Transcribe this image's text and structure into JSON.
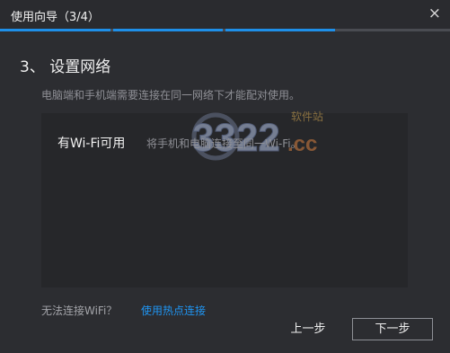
{
  "window": {
    "title": "使用向导（3/4）",
    "close_icon": "close-icon",
    "close_glyph": "×"
  },
  "progress": {
    "total_steps": 4,
    "current_step": 3,
    "active_color": "#1e8fe8",
    "inactive_color": "#4a4c52"
  },
  "step": {
    "title": "3、 设置网络",
    "subtitle": "电脑端和手机端需要连接在同一网络下才能配对使用。"
  },
  "wifi_option": {
    "title": "有Wi-Fi可用",
    "description": "将手机和电脑连接至同一Wi-Fi。"
  },
  "watermark": {
    "text": "3322",
    "suffix": ".cc",
    "tag": "软件站"
  },
  "help": {
    "text": "无法连接WiFi？",
    "link_label": "使用热点连接",
    "link_color": "#1f95f2"
  },
  "buttons": {
    "prev_label": "上一步",
    "next_label": "下一步"
  }
}
